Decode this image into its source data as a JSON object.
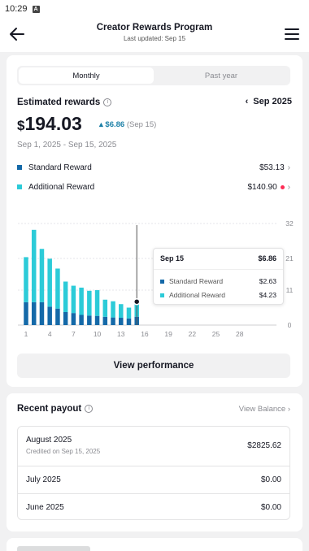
{
  "status_bar": {
    "time": "10:29",
    "sim_label": "A"
  },
  "header": {
    "title": "Creator Rewards Program",
    "subtitle": "Last updated: Sep 15"
  },
  "tabs": [
    {
      "label": "Monthly",
      "active": true
    },
    {
      "label": "Past year",
      "active": false
    }
  ],
  "estimate": {
    "label": "Estimated rewards",
    "month": "Sep 2025",
    "currency": "$",
    "amount": "194.03",
    "change": "▴ $6.86",
    "change_date": "(Sep 15)",
    "range": "Sep 1, 2025 - Sep 15, 2025"
  },
  "legend": [
    {
      "name": "Standard Reward",
      "value": "$53.13",
      "color": "#1469a8"
    },
    {
      "name": "Additional Reward",
      "value": "$140.90",
      "color": "#2ccbd8",
      "alert": true
    }
  ],
  "chart_data": {
    "type": "bar",
    "stacked": true,
    "x": [
      1,
      2,
      3,
      4,
      5,
      6,
      7,
      8,
      9,
      10,
      11,
      12,
      13,
      14,
      15
    ],
    "x_ticks": [
      "1",
      "4",
      "7",
      "10",
      "13",
      "16",
      "19",
      "22",
      "25",
      "28"
    ],
    "y_ticks": [
      "32",
      "21",
      "11",
      "0"
    ],
    "ylim": [
      0,
      32
    ],
    "series": [
      {
        "name": "Standard Reward",
        "color": "#1469a8",
        "values": [
          7.2,
          7.2,
          7.2,
          5.8,
          5.2,
          4.1,
          3.8,
          3.2,
          3.0,
          2.9,
          2.6,
          2.4,
          2.3,
          2.1,
          2.63
        ]
      },
      {
        "name": "Additional Reward",
        "color": "#2ccbd8",
        "values": [
          14.2,
          22.8,
          16.8,
          15.1,
          12.6,
          9.6,
          8.6,
          8.6,
          7.8,
          8.1,
          5.4,
          5.1,
          4.3,
          3.4,
          4.23
        ]
      }
    ],
    "tooltip": {
      "date": "Sep 15",
      "total": "$6.86",
      "rows": [
        {
          "name": "Standard Reward",
          "value": "$2.63"
        },
        {
          "name": "Additional Reward",
          "value": "$4.23"
        }
      ]
    }
  },
  "perf_button": "View performance",
  "recent_payout": {
    "title": "Recent payout",
    "view_balance": "View Balance ›",
    "rows": [
      {
        "month": "August 2025",
        "sub": "Credited on Sep 15, 2025",
        "amount": "$2825.62"
      },
      {
        "month": "July 2025",
        "sub": "",
        "amount": "$0.00"
      },
      {
        "month": "June 2025",
        "sub": "",
        "amount": "$0.00"
      }
    ]
  }
}
